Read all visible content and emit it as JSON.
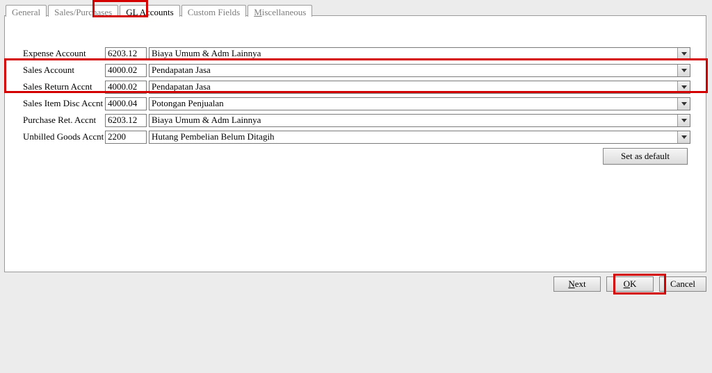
{
  "tabs": {
    "general": "General",
    "sales_purchases": "Sales/Purchases",
    "gl_accounts_prefix": "G",
    "gl_accounts_letter": "L",
    "gl_accounts_suffix": " Accounts",
    "custom_fields": "Custom Fields",
    "miscellaneous_letter": "M",
    "miscellaneous_suffix": "iscellaneous"
  },
  "rows": {
    "expense": {
      "label": "Expense Account",
      "code": "6203.12",
      "desc": "Biaya Umum & Adm Lainnya"
    },
    "sales": {
      "label": "Sales Account",
      "code": "4000.02",
      "desc": "Pendapatan Jasa"
    },
    "sales_return": {
      "label": "Sales Return Accnt",
      "code": "4000.02",
      "desc": "Pendapatan Jasa"
    },
    "sales_disc": {
      "label": "Sales Item Disc Accnt",
      "code": "4000.04",
      "desc": "Potongan Penjualan"
    },
    "purchase_ret": {
      "label": "Purchase Ret. Accnt",
      "code": "6203.12",
      "desc": "Biaya Umum & Adm Lainnya"
    },
    "unbilled": {
      "label": "Unbilled Goods Accnt",
      "code": "2200",
      "desc": "Hutang Pembelian Belum Ditagih"
    }
  },
  "buttons": {
    "set_default": "Set as default",
    "next_letter": "N",
    "next_suffix": "ext",
    "ok_letter": "O",
    "ok_suffix": "K",
    "cancel": "Cancel"
  }
}
